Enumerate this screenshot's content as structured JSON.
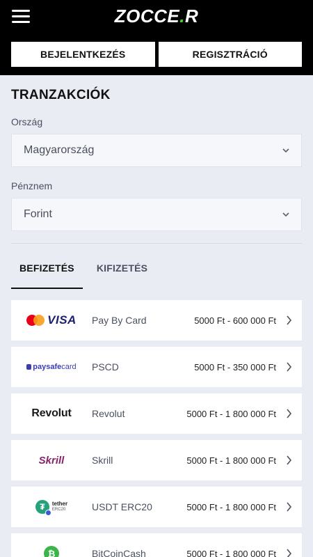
{
  "header": {
    "logo_main": "ZOCCE",
    "logo_end": "R",
    "login_label": "BEJELENTKEZÉS",
    "register_label": "REGISZTRÁCIÓ"
  },
  "page": {
    "title": "TRANZAKCIÓK",
    "country_label": "Ország",
    "country_value": "Magyarország",
    "currency_label": "Pénznem",
    "currency_value": "Forint"
  },
  "tabs": [
    {
      "label": "BEFIZETÉS",
      "active": true
    },
    {
      "label": "KIFIZETÉS",
      "active": false
    }
  ],
  "methods": [
    {
      "name": "Pay By Card",
      "range": "5000 Ft - 600 000 Ft",
      "logo_text": "VISA"
    },
    {
      "name": "PSCD",
      "range": "5000 Ft - 350 000 Ft",
      "logo_text_a": "paysafe",
      "logo_text_b": "card"
    },
    {
      "name": "Revolut",
      "range": "5000 Ft - 1 800 000 Ft",
      "logo_text": "Revolut"
    },
    {
      "name": "Skrill",
      "range": "5000 Ft - 1 800 000 Ft",
      "logo_text": "Skrill"
    },
    {
      "name": "USDT ERC20",
      "range": "5000 Ft - 1 800 000 Ft",
      "logo_text_a": "tether",
      "logo_text_b": "ERC20"
    },
    {
      "name": "BitCoinCash",
      "range": "5000 Ft - 1 800 000 Ft"
    }
  ],
  "icons": {
    "menu": "hamburger-menu-icon",
    "chevron_down": "chevron-down-icon",
    "chevron_right": "chevron-right-icon"
  },
  "colors": {
    "header_bg": "#000000",
    "page_bg": "#e9ecf3",
    "logo_accent": "#3ddc1a"
  }
}
